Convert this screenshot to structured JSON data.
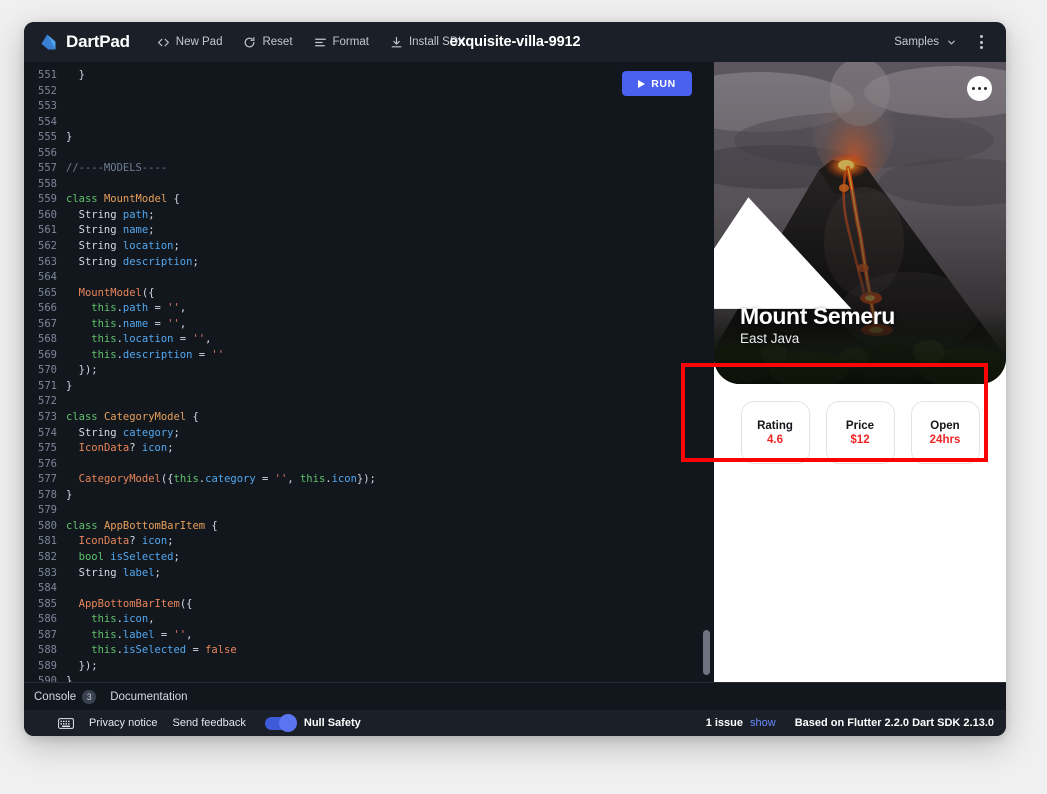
{
  "header": {
    "brand": "DartPad",
    "doc_title": "exquisite-villa-9912",
    "actions": [
      {
        "label": "New Pad",
        "icon": "code-brackets-icon"
      },
      {
        "label": "Reset",
        "icon": "refresh-icon"
      },
      {
        "label": "Format",
        "icon": "format-lines-icon"
      },
      {
        "label": "Install SDK",
        "icon": "download-icon"
      }
    ],
    "samples_label": "Samples",
    "menu_icon": "kebab-menu-icon"
  },
  "editor": {
    "run_label": "RUN",
    "run_icon": "play-icon",
    "first_line_number": 551,
    "lines": [
      {
        "n": 551,
        "tokens": [
          {
            "t": "  }",
            "c": "t-pun"
          }
        ]
      },
      {
        "n": 552,
        "tokens": []
      },
      {
        "n": 553,
        "tokens": []
      },
      {
        "n": 554,
        "tokens": []
      },
      {
        "n": 555,
        "tokens": [
          {
            "t": "}",
            "c": "t-pun"
          }
        ]
      },
      {
        "n": 556,
        "tokens": []
      },
      {
        "n": 557,
        "tokens": [
          {
            "t": "//----MODELS----",
            "c": "t-com"
          }
        ]
      },
      {
        "n": 558,
        "tokens": []
      },
      {
        "n": 559,
        "tokens": [
          {
            "t": "class ",
            "c": "t-kw"
          },
          {
            "t": "MountModel",
            "c": "t-cls"
          },
          {
            "t": " {",
            "c": "t-pun"
          }
        ]
      },
      {
        "n": 560,
        "tokens": [
          {
            "t": "  String ",
            "c": "t-pun"
          },
          {
            "t": "path",
            "c": "t-prop"
          },
          {
            "t": ";",
            "c": "t-pun"
          }
        ]
      },
      {
        "n": 561,
        "tokens": [
          {
            "t": "  String ",
            "c": "t-pun"
          },
          {
            "t": "name",
            "c": "t-prop"
          },
          {
            "t": ";",
            "c": "t-pun"
          }
        ]
      },
      {
        "n": 562,
        "tokens": [
          {
            "t": "  String ",
            "c": "t-pun"
          },
          {
            "t": "location",
            "c": "t-prop"
          },
          {
            "t": ";",
            "c": "t-pun"
          }
        ]
      },
      {
        "n": 563,
        "tokens": [
          {
            "t": "  String ",
            "c": "t-pun"
          },
          {
            "t": "description",
            "c": "t-prop"
          },
          {
            "t": ";",
            "c": "t-pun"
          }
        ]
      },
      {
        "n": 564,
        "tokens": []
      },
      {
        "n": 565,
        "tokens": [
          {
            "t": "  ",
            "c": "t-pun"
          },
          {
            "t": "MountModel",
            "c": "t-type"
          },
          {
            "t": "({",
            "c": "t-pun"
          }
        ]
      },
      {
        "n": 566,
        "tokens": [
          {
            "t": "    this",
            "c": "t-kw"
          },
          {
            "t": ".",
            "c": "t-pun"
          },
          {
            "t": "path",
            "c": "t-prop"
          },
          {
            "t": " = ",
            "c": "t-pun"
          },
          {
            "t": "''",
            "c": "t-str"
          },
          {
            "t": ",",
            "c": "t-pun"
          }
        ]
      },
      {
        "n": 567,
        "tokens": [
          {
            "t": "    this",
            "c": "t-kw"
          },
          {
            "t": ".",
            "c": "t-pun"
          },
          {
            "t": "name",
            "c": "t-prop"
          },
          {
            "t": " = ",
            "c": "t-pun"
          },
          {
            "t": "''",
            "c": "t-str"
          },
          {
            "t": ",",
            "c": "t-pun"
          }
        ]
      },
      {
        "n": 568,
        "tokens": [
          {
            "t": "    this",
            "c": "t-kw"
          },
          {
            "t": ".",
            "c": "t-pun"
          },
          {
            "t": "location",
            "c": "t-prop"
          },
          {
            "t": " = ",
            "c": "t-pun"
          },
          {
            "t": "''",
            "c": "t-str"
          },
          {
            "t": ",",
            "c": "t-pun"
          }
        ]
      },
      {
        "n": 569,
        "tokens": [
          {
            "t": "    this",
            "c": "t-kw"
          },
          {
            "t": ".",
            "c": "t-pun"
          },
          {
            "t": "description",
            "c": "t-prop"
          },
          {
            "t": " = ",
            "c": "t-pun"
          },
          {
            "t": "''",
            "c": "t-str"
          }
        ]
      },
      {
        "n": 570,
        "tokens": [
          {
            "t": "  });",
            "c": "t-pun"
          }
        ]
      },
      {
        "n": 571,
        "tokens": [
          {
            "t": "}",
            "c": "t-pun"
          }
        ]
      },
      {
        "n": 572,
        "tokens": []
      },
      {
        "n": 573,
        "tokens": [
          {
            "t": "class ",
            "c": "t-kw"
          },
          {
            "t": "CategoryModel",
            "c": "t-cls"
          },
          {
            "t": " {",
            "c": "t-pun"
          }
        ]
      },
      {
        "n": 574,
        "tokens": [
          {
            "t": "  String ",
            "c": "t-pun"
          },
          {
            "t": "category",
            "c": "t-prop"
          },
          {
            "t": ";",
            "c": "t-pun"
          }
        ]
      },
      {
        "n": 575,
        "tokens": [
          {
            "t": "  ",
            "c": "t-pun"
          },
          {
            "t": "IconData",
            "c": "t-type"
          },
          {
            "t": "? ",
            "c": "t-pun"
          },
          {
            "t": "icon",
            "c": "t-prop"
          },
          {
            "t": ";",
            "c": "t-pun"
          }
        ]
      },
      {
        "n": 576,
        "tokens": []
      },
      {
        "n": 577,
        "tokens": [
          {
            "t": "  ",
            "c": "t-pun"
          },
          {
            "t": "CategoryModel",
            "c": "t-type"
          },
          {
            "t": "({",
            "c": "t-pun"
          },
          {
            "t": "this",
            "c": "t-kw"
          },
          {
            "t": ".",
            "c": "t-pun"
          },
          {
            "t": "category",
            "c": "t-prop"
          },
          {
            "t": " = ",
            "c": "t-pun"
          },
          {
            "t": "''",
            "c": "t-str"
          },
          {
            "t": ", ",
            "c": "t-pun"
          },
          {
            "t": "this",
            "c": "t-kw"
          },
          {
            "t": ".",
            "c": "t-pun"
          },
          {
            "t": "icon",
            "c": "t-prop"
          },
          {
            "t": "});",
            "c": "t-pun"
          }
        ]
      },
      {
        "n": 578,
        "tokens": [
          {
            "t": "}",
            "c": "t-pun"
          }
        ]
      },
      {
        "n": 579,
        "tokens": []
      },
      {
        "n": 580,
        "tokens": [
          {
            "t": "class ",
            "c": "t-kw"
          },
          {
            "t": "AppBottomBarItem",
            "c": "t-cls"
          },
          {
            "t": " {",
            "c": "t-pun"
          }
        ]
      },
      {
        "n": 581,
        "tokens": [
          {
            "t": "  ",
            "c": "t-pun"
          },
          {
            "t": "IconData",
            "c": "t-type"
          },
          {
            "t": "? ",
            "c": "t-pun"
          },
          {
            "t": "icon",
            "c": "t-prop"
          },
          {
            "t": ";",
            "c": "t-pun"
          }
        ]
      },
      {
        "n": 582,
        "tokens": [
          {
            "t": "  bool ",
            "c": "t-kw"
          },
          {
            "t": "isSelected",
            "c": "t-prop"
          },
          {
            "t": ";",
            "c": "t-pun"
          }
        ]
      },
      {
        "n": 583,
        "tokens": [
          {
            "t": "  String ",
            "c": "t-pun"
          },
          {
            "t": "label",
            "c": "t-prop"
          },
          {
            "t": ";",
            "c": "t-pun"
          }
        ]
      },
      {
        "n": 584,
        "tokens": []
      },
      {
        "n": 585,
        "tokens": [
          {
            "t": "  ",
            "c": "t-pun"
          },
          {
            "t": "AppBottomBarItem",
            "c": "t-type"
          },
          {
            "t": "({",
            "c": "t-pun"
          }
        ]
      },
      {
        "n": 586,
        "tokens": [
          {
            "t": "    this",
            "c": "t-kw"
          },
          {
            "t": ".",
            "c": "t-pun"
          },
          {
            "t": "icon",
            "c": "t-prop"
          },
          {
            "t": ",",
            "c": "t-pun"
          }
        ]
      },
      {
        "n": 587,
        "tokens": [
          {
            "t": "    this",
            "c": "t-kw"
          },
          {
            "t": ".",
            "c": "t-pun"
          },
          {
            "t": "label",
            "c": "t-prop"
          },
          {
            "t": " = ",
            "c": "t-pun"
          },
          {
            "t": "''",
            "c": "t-str"
          },
          {
            "t": ",",
            "c": "t-pun"
          }
        ]
      },
      {
        "n": 588,
        "tokens": [
          {
            "t": "    this",
            "c": "t-kw"
          },
          {
            "t": ".",
            "c": "t-pun"
          },
          {
            "t": "isSelected",
            "c": "t-prop"
          },
          {
            "t": " = ",
            "c": "t-pun"
          },
          {
            "t": "false",
            "c": "t-lit"
          }
        ]
      },
      {
        "n": 589,
        "tokens": [
          {
            "t": "  });",
            "c": "t-pun"
          }
        ]
      },
      {
        "n": 590,
        "tokens": [
          {
            "t": "}",
            "c": "t-pun"
          }
        ]
      }
    ]
  },
  "preview": {
    "mountain_icon": "mountain-icon",
    "more_icon": "more-horizontal-icon",
    "title": "Mount Semeru",
    "subtitle": "East Java",
    "info_cards": [
      {
        "label": "Rating",
        "value": "4.6"
      },
      {
        "label": "Price",
        "value": "$12"
      },
      {
        "label": "Open",
        "value": "24hrs"
      }
    ],
    "value_color": "#ef2626"
  },
  "console": {
    "tab_console": "Console",
    "badge_count": "3",
    "tab_documentation": "Documentation"
  },
  "status": {
    "keyboard_icon": "keyboard-icon",
    "privacy": "Privacy notice",
    "feedback": "Send feedback",
    "null_safety": "Null Safety",
    "issue_count": "1 issue",
    "show": "show",
    "version": "Based on Flutter 2.2.0 Dart SDK 2.13.0"
  },
  "highlight": {
    "color": "#f90505"
  }
}
